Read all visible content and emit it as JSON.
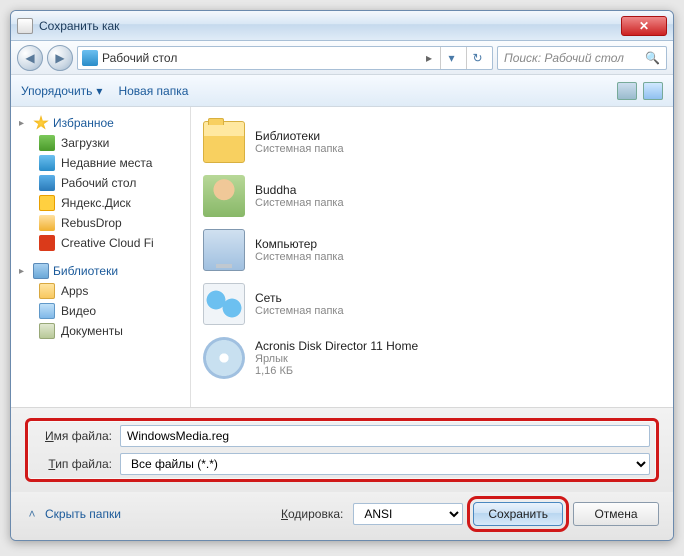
{
  "title": "Сохранить как",
  "nav": {
    "location": "Рабочий стол",
    "arrow": "▸",
    "search_placeholder": "Поиск: Рабочий стол"
  },
  "toolbar": {
    "organize": "Упорядочить",
    "new_folder": "Новая папка",
    "dropdown_glyph": "▾"
  },
  "sidebar": {
    "favorites": {
      "label": "Избранное",
      "items": [
        {
          "label": "Загрузки",
          "icon": "ic-dl"
        },
        {
          "label": "Недавние места",
          "icon": "ic-recent"
        },
        {
          "label": "Рабочий стол",
          "icon": "ic-desktop"
        },
        {
          "label": "Яндекс.Диск",
          "icon": "ic-yd"
        },
        {
          "label": "RebusDrop",
          "icon": "ic-rd"
        },
        {
          "label": "Creative Cloud Fi",
          "icon": "ic-cc"
        }
      ]
    },
    "libraries": {
      "label": "Библиотеки",
      "items": [
        {
          "label": "Apps",
          "icon": "ic-app"
        },
        {
          "label": "Видео",
          "icon": "ic-vid"
        },
        {
          "label": "Документы",
          "icon": "ic-doc"
        }
      ]
    }
  },
  "files": [
    {
      "name": "Библиотеки",
      "meta": "Системная папка",
      "icon": "fi-lib"
    },
    {
      "name": "Buddha",
      "meta": "Системная папка",
      "icon": "fi-user"
    },
    {
      "name": "Компьютер",
      "meta": "Системная папка",
      "icon": "fi-comp"
    },
    {
      "name": "Сеть",
      "meta": "Системная папка",
      "icon": "fi-net"
    },
    {
      "name": "Acronis Disk Director 11 Home",
      "meta": "Ярлык",
      "meta2": "1,16 КБ",
      "icon": "fi-disc"
    }
  ],
  "form": {
    "filename_label": "Имя файла:",
    "filename_value": "WindowsMedia.reg",
    "filetype_label": "Тип файла:",
    "filetype_value": "Все файлы  (*.*)"
  },
  "footer": {
    "hide_folders": "Скрыть папки",
    "encoding_label": "Кодировка:",
    "encoding_value": "ANSI",
    "save": "Сохранить",
    "cancel": "Отмена"
  }
}
